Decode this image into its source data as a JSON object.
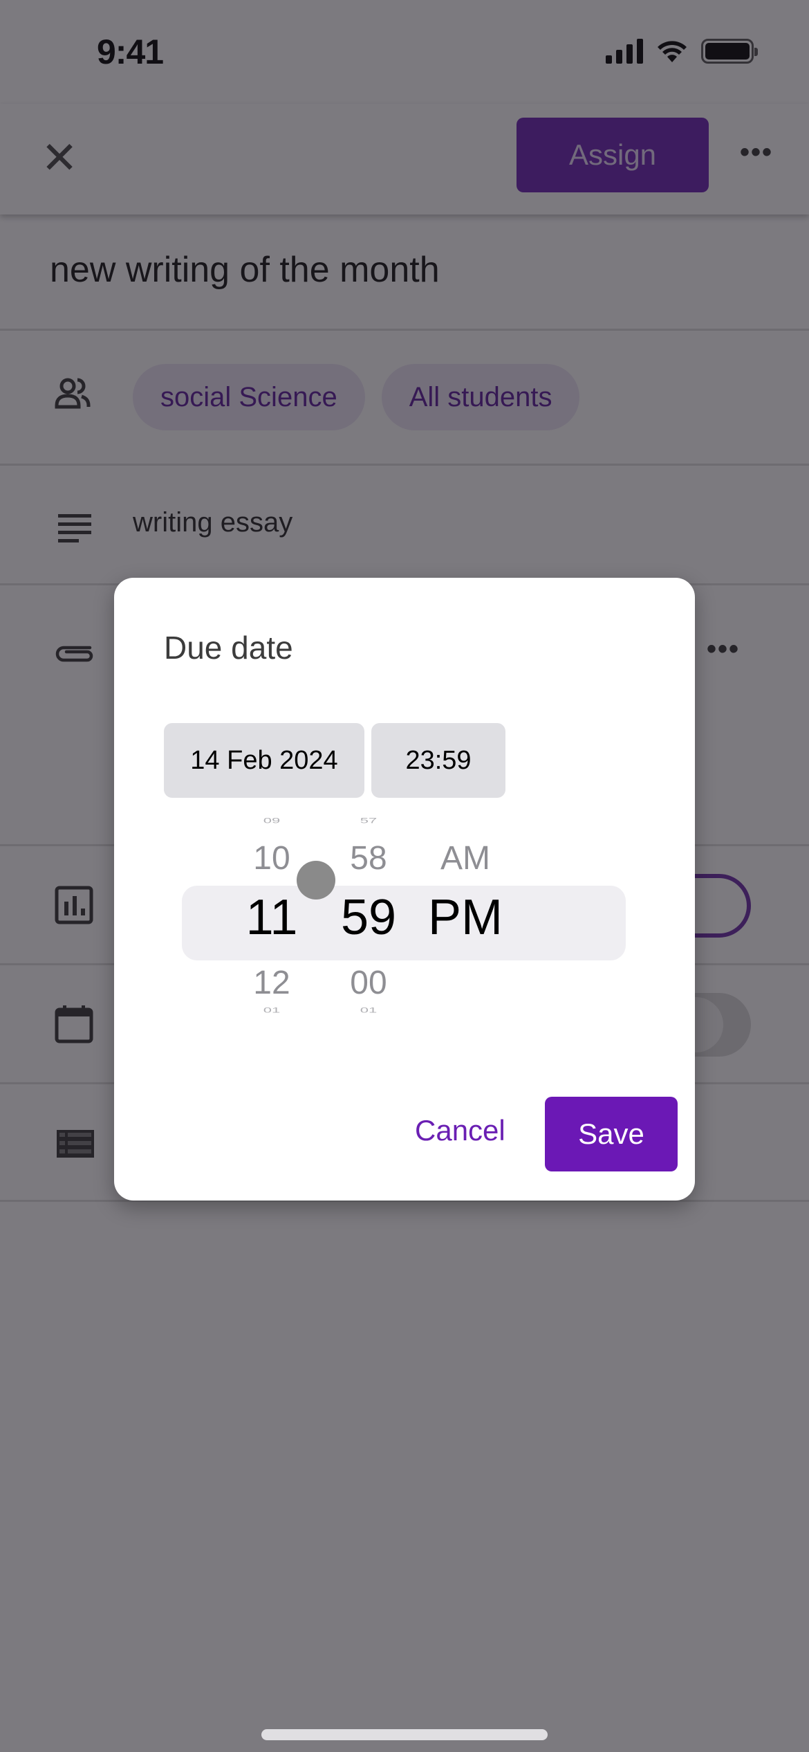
{
  "status_bar": {
    "time": "9:41",
    "icons": [
      "signal-icon",
      "wifi-icon",
      "battery-icon"
    ]
  },
  "app_bar": {
    "close_icon": "close-icon",
    "assign_label": "Assign",
    "more_icon": "more-horizontal-icon",
    "assign_color": "#6a1fb3"
  },
  "assignment": {
    "title": "new writing of the month",
    "recipients": [
      "social Science",
      "All students"
    ],
    "description": "writing essay"
  },
  "rows": {
    "people_icon": "people-icon",
    "description_icon": "notes-icon",
    "attachment_icon": "paperclip-icon",
    "attachment_more_icon": "more-horizontal-icon",
    "grading_icon": "bar-chart-icon",
    "grading_toggle_on": true,
    "due_icon": "calendar-icon",
    "due_toggle_on": false,
    "topic_icon": "list-icon"
  },
  "dialog": {
    "title": "Due date",
    "date_value": "14 Feb 2024",
    "time_value": "23:59",
    "picker": {
      "hour": {
        "far_prev": "09",
        "prev": "10",
        "selected": "11",
        "next": "12",
        "far_next": "01"
      },
      "minute": {
        "far_prev": "57",
        "prev": "58",
        "selected": "59",
        "next": "00",
        "far_next": "01"
      },
      "period": {
        "prev": "AM",
        "selected": "PM"
      }
    },
    "cancel_label": "Cancel",
    "save_label": "Save",
    "accent_color": "#6b18b5"
  }
}
